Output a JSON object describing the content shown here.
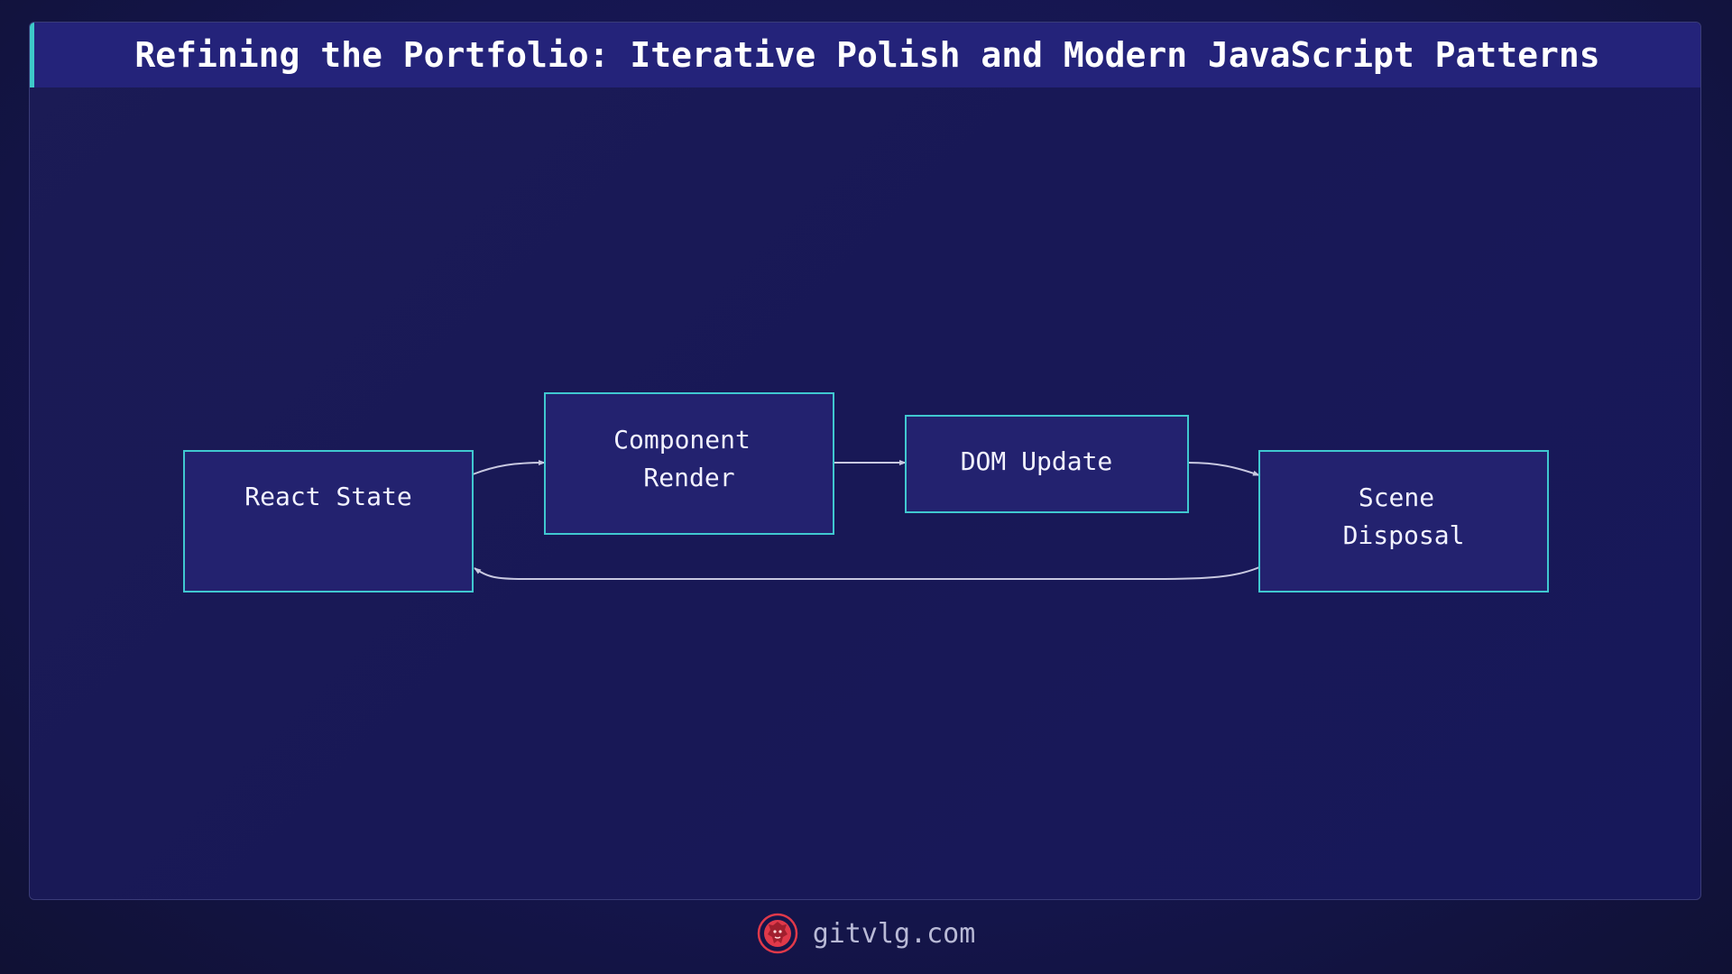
{
  "header": {
    "title": "Refining the Portfolio: Iterative Polish and Modern JavaScript Patterns"
  },
  "diagram": {
    "nodes": [
      {
        "id": "react-state",
        "lines": [
          "React State"
        ]
      },
      {
        "id": "component-render",
        "lines": [
          "Component",
          "Render"
        ]
      },
      {
        "id": "dom-update",
        "lines": [
          "DOM Update"
        ]
      },
      {
        "id": "scene-disposal",
        "lines": [
          "Scene",
          "Disposal"
        ]
      }
    ],
    "edges": [
      {
        "from": "react-state",
        "to": "component-render"
      },
      {
        "from": "component-render",
        "to": "dom-update"
      },
      {
        "from": "dom-update",
        "to": "scene-disposal"
      },
      {
        "from": "scene-disposal",
        "to": "react-state"
      }
    ]
  },
  "footer": {
    "site": "gitvlg.com",
    "logo_icon": "lion-logo-icon"
  },
  "colors": {
    "background": "#151650",
    "node_fill": "#23226f",
    "node_border": "#40c8d0",
    "accent": "#3ec9c9",
    "edge": "#c8c8e0",
    "logo": "#e0394a"
  }
}
